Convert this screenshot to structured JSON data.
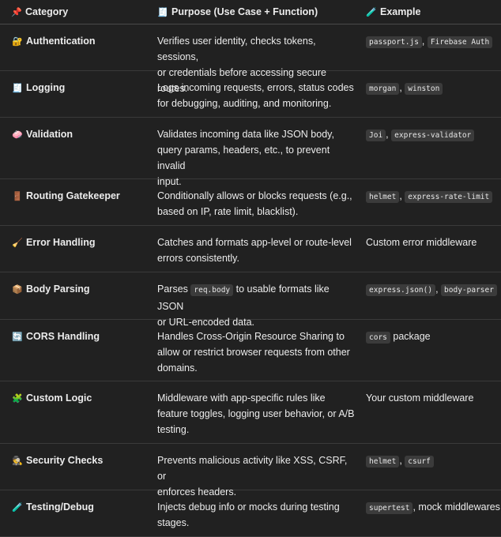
{
  "header": {
    "category": {
      "icon": "pushpin-icon",
      "glyph": "📌",
      "label": "Category"
    },
    "purpose": {
      "icon": "receipt-icon",
      "glyph": "🧾",
      "label": "Purpose (Use Case + Function)"
    },
    "example": {
      "icon": "test-tube-icon",
      "glyph": "🧪",
      "label": "Example"
    }
  },
  "rows": [
    {
      "glyph": "🔐",
      "icon": "lock-with-key-icon",
      "category": "Authentication",
      "purpose": [
        "Verifies user identity, checks tokens, sessions,",
        "or credentials before accessing secure routes."
      ],
      "example": [
        {
          "code": "passport.js"
        },
        {
          "text": ", "
        },
        {
          "code": "Firebase Auth"
        }
      ]
    },
    {
      "glyph": "🧾",
      "icon": "receipt-icon",
      "category": "Logging",
      "purpose": [
        "Logs incoming requests, errors, status codes",
        "for debugging, auditing, and monitoring."
      ],
      "example": [
        {
          "code": "morgan"
        },
        {
          "text": ", "
        },
        {
          "code": "winston"
        }
      ]
    },
    {
      "glyph": "🧼",
      "icon": "soap-icon",
      "category": "Validation",
      "purpose": [
        "Validates incoming data like JSON body,",
        "query params, headers, etc., to prevent invalid",
        "input."
      ],
      "example": [
        {
          "code": "Joi"
        },
        {
          "text": ", "
        },
        {
          "code": "express-validator"
        }
      ]
    },
    {
      "glyph": "🚪",
      "icon": "door-icon",
      "category": "Routing Gatekeeper",
      "purpose": [
        "Conditionally allows or blocks requests (e.g.,",
        "based on IP, rate limit, blacklist)."
      ],
      "example": [
        {
          "code": "helmet"
        },
        {
          "text": ", "
        },
        {
          "code": "express-rate-limit"
        }
      ]
    },
    {
      "glyph": "🧹",
      "icon": "broom-icon",
      "category": "Error Handling",
      "purpose": [
        "Catches and formats app-level or route-level",
        "errors consistently."
      ],
      "example": [
        {
          "text": "Custom error middleware"
        }
      ]
    },
    {
      "glyph": "📦",
      "icon": "package-icon",
      "category": "Body Parsing",
      "purpose_parts": [
        [
          {
            "text": "Parses "
          },
          {
            "code": "req.body"
          },
          {
            "text": " to usable formats like JSON"
          }
        ],
        [
          {
            "text": "or URL-encoded data."
          }
        ]
      ],
      "example": [
        {
          "code": "express.json()"
        },
        {
          "text": ", "
        },
        {
          "code": "body-parser"
        }
      ]
    },
    {
      "glyph": "🔄",
      "icon": "arrows-cycle-icon",
      "category": "CORS Handling",
      "purpose": [
        "Handles Cross-Origin Resource Sharing to",
        "allow or restrict browser requests from other",
        "domains."
      ],
      "example": [
        {
          "code": "cors"
        },
        {
          "text": " package"
        }
      ]
    },
    {
      "glyph": "🧩",
      "icon": "puzzle-piece-icon",
      "category": "Custom Logic",
      "purpose": [
        "Middleware with app-specific rules like",
        "feature toggles, logging user behavior, or A/B",
        "testing."
      ],
      "example": [
        {
          "text": "Your custom middleware"
        }
      ]
    },
    {
      "glyph": "🕵️",
      "icon": "detective-icon",
      "category": "Security Checks",
      "purpose": [
        "Prevents malicious activity like XSS, CSRF, or",
        "enforces headers."
      ],
      "example": [
        {
          "code": "helmet"
        },
        {
          "text": ", "
        },
        {
          "code": "csurf"
        }
      ]
    },
    {
      "glyph": "🧪",
      "icon": "test-tube-icon",
      "category": "Testing/Debug",
      "purpose": [
        "Injects debug info or mocks during testing",
        "stages."
      ],
      "example": [
        {
          "code": "supertest"
        },
        {
          "text": ", mock middlewares"
        }
      ]
    }
  ]
}
